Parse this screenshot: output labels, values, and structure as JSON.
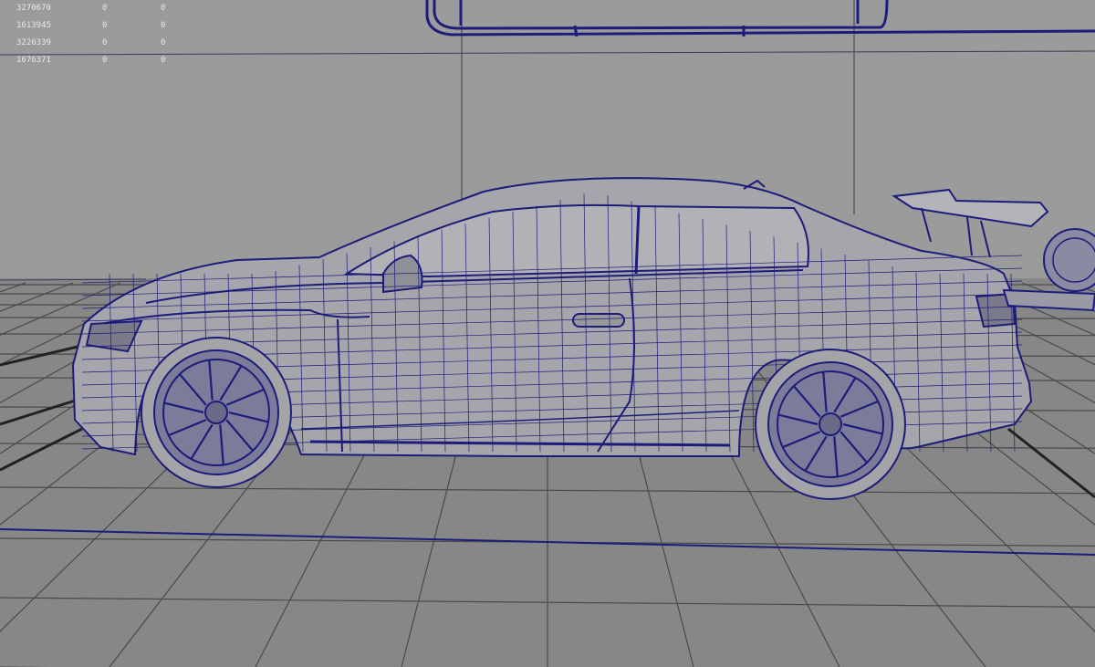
{
  "hud": {
    "rows": [
      {
        "value": "3270670",
        "col1": "0",
        "col2": "0"
      },
      {
        "value": "1613945",
        "col1": "0",
        "col2": "0"
      },
      {
        "value": "3226339",
        "col1": "0",
        "col2": "0"
      },
      {
        "value": "1676371",
        "col1": "0",
        "col2": "0"
      }
    ]
  },
  "colors": {
    "background_wall": "#9a9a9a",
    "floor": "#868686",
    "grid_line": "#444444",
    "wireframe": "#1c1c7a",
    "surface": "#a3a3a8"
  }
}
